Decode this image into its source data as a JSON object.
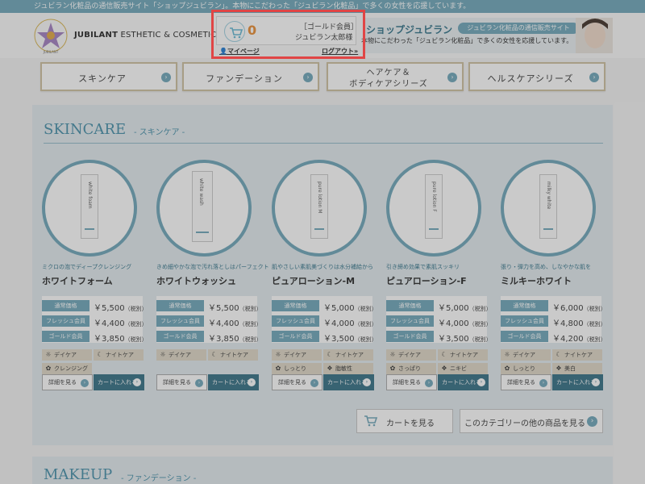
{
  "topbar": {
    "text": "ジュビラン化粧品の通信販売サイト「ショップジュビラン」。本物にこだわった「ジュビラン化粧品」で多くの女性を応援しています。"
  },
  "header": {
    "brand_bold": "JUBILANT",
    "brand_rest": " ESTHETIC & COSMETICS",
    "emblem_text": "JUBILANT"
  },
  "account": {
    "cart_count": "0",
    "member_rank": "［ゴールド会員］",
    "member_name": "ジュビラン太郎様",
    "mypage_label": "マイページ",
    "logout_label": "ログアウト»"
  },
  "banner": {
    "title": "ショップジュビラン",
    "badge": "ジュビラン化粧品の通信販売サイト",
    "text": "本物にこだわった「ジュビラン化粧品」で多くの女性を応援しています。"
  },
  "nav": [
    {
      "label": "スキンケア",
      "label2": ""
    },
    {
      "label": "ファンデーション",
      "label2": ""
    },
    {
      "label": "ヘアケア＆",
      "label2": "ボディケアシリーズ"
    },
    {
      "label": "ヘルスケアシリーズ",
      "label2": ""
    }
  ],
  "skincare": {
    "title": "SKINCARE",
    "subtitle": "- スキンケア -",
    "price_labels": [
      "通常価格",
      "フレッシュ会員",
      "ゴールド会員"
    ],
    "tax_note": "（税別）",
    "detail_label": "詳細を見る",
    "cart_label": "カートに入れる",
    "products": [
      {
        "name": "ホワイトフォーム",
        "tagline": "ミクロの泡でディープクレンジング",
        "bottle_text": "white foam",
        "prices": [
          "￥5,500",
          "￥4,400",
          "￥3,850"
        ],
        "chips": [
          "デイケア",
          "ナイトケア",
          "クレンジング"
        ]
      },
      {
        "name": "ホワイトウォッシュ",
        "tagline": "きめ細やかな泡で汚れ落としはパーフェクト",
        "bottle_text": "white wash",
        "prices": [
          "￥5,500",
          "￥4,400",
          "￥3,850"
        ],
        "chips": [
          "デイケア",
          "ナイトケア"
        ]
      },
      {
        "name": "ピュアローション-M",
        "tagline": "肌やさしい素肌美づくりは水分補給から",
        "bottle_text": "pure lotion M",
        "prices": [
          "￥5,000",
          "￥4,000",
          "￥3,500"
        ],
        "chips": [
          "デイケア",
          "ナイトケア",
          "しっとり",
          "脂敏性"
        ]
      },
      {
        "name": "ピュアローション-F",
        "tagline": "引き締め効果で素肌スッキリ",
        "bottle_text": "pure lotion F",
        "prices": [
          "￥5,000",
          "￥4,000",
          "￥3,500"
        ],
        "chips": [
          "デイケア",
          "ナイトケア",
          "さっぱり",
          "ニキビ"
        ]
      },
      {
        "name": "ミルキーホワイト",
        "tagline": "張り・弾力を高め、しなやかな肌を",
        "bottle_text": "milky white",
        "prices": [
          "￥6,000",
          "￥4,800",
          "￥4,200"
        ],
        "chips": [
          "デイケア",
          "ナイトケア",
          "しっとり",
          "美白"
        ]
      }
    ],
    "view_cart_label": "カートを見る",
    "more_category_label": "このカテゴリーの他の商品を見る"
  },
  "makeup": {
    "title": "MAKEUP",
    "subtitle": "- ファンデーション -"
  },
  "colors": {
    "accent": "#6aa4b8",
    "dark_accent": "#2f6c82",
    "highlight": "#e04545",
    "cart_count": "#e98a2e"
  }
}
